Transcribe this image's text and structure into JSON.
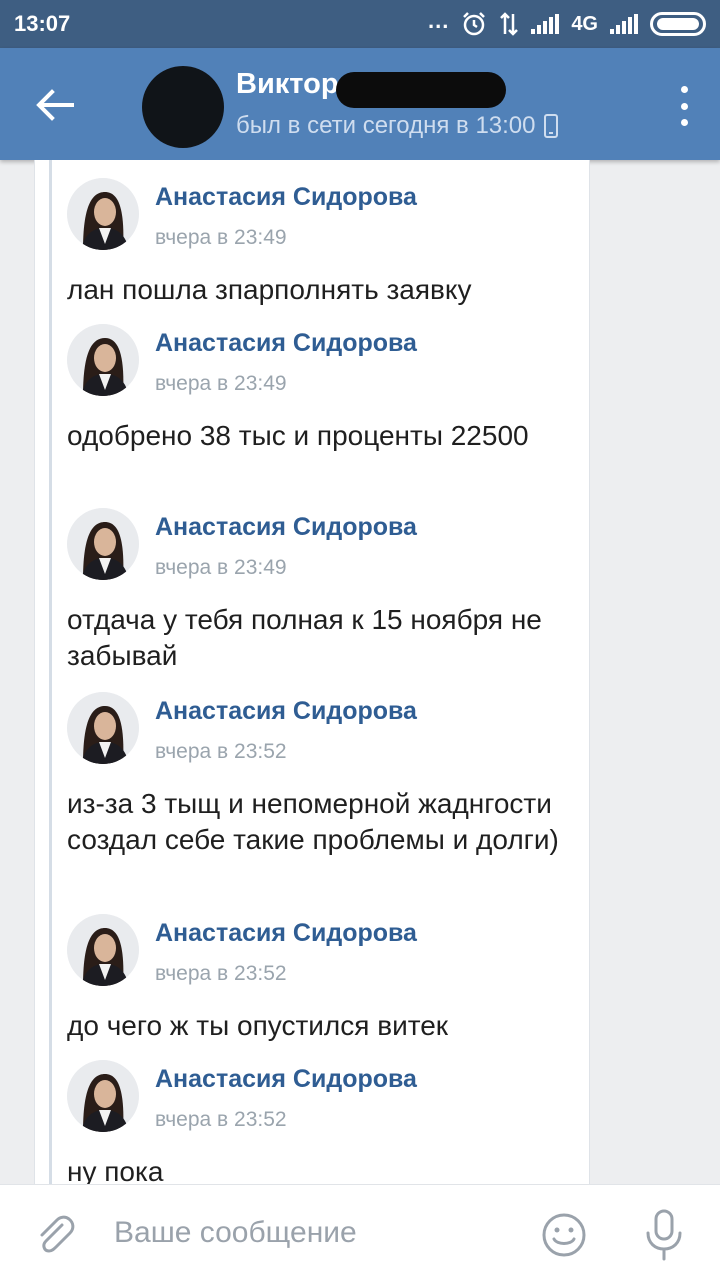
{
  "status_bar": {
    "time": "13:07",
    "dots": "...",
    "network": "4G"
  },
  "header": {
    "name": "Виктор",
    "status": "был в сети сегодня в 13:00"
  },
  "messages": [
    {
      "author": "Анастасия Сидорова",
      "time": "вчера в 23:49",
      "text": "лан пошла зпарполнять заявку"
    },
    {
      "author": "Анастасия Сидорова",
      "time": "вчера в 23:49",
      "text": "одобрено 38 тыс и проценты 22500"
    },
    {
      "author": "Анастасия Сидорова",
      "time": "вчера в 23:49",
      "text": "отдача у тебя полная к 15 ноября не забывай"
    },
    {
      "author": "Анастасия Сидорова",
      "time": "вчера в 23:52",
      "text": "из-за 3 тыщ и непомерной жаднгости создал себе такие проблемы и долги)"
    },
    {
      "author": "Анастасия Сидорова",
      "time": "вчера в 23:52",
      "text": "до чего ж ты опустился витек"
    },
    {
      "author": "Анастасия Сидорова",
      "time": "вчера в 23:52",
      "text": "ну пока"
    }
  ],
  "input": {
    "placeholder": "Ваше сообщение"
  },
  "icons": {
    "back": "arrow-left-icon",
    "menu": "more-vertical-icon",
    "attach": "paperclip-icon",
    "emoji": "smile-icon",
    "mic": "microphone-icon"
  },
  "colors": {
    "header": "#5181b8",
    "status_bar": "#3e5e82",
    "author": "#2f5d93"
  }
}
